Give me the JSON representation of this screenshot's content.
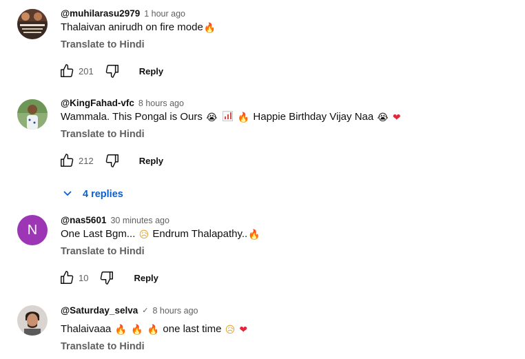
{
  "translate_label": "Translate to Hindi",
  "reply_label": "Reply",
  "colors": {
    "link_blue": "#065fd4",
    "secondary_text": "#606060",
    "avatar_purple": "#9c36b5"
  },
  "comments": [
    {
      "author": "@muhilarasu2979",
      "time": "1 hour ago",
      "text": "Thalaivan anirudh on fire mode",
      "text_emojis": [
        "fire"
      ],
      "likes": "201",
      "avatar": "image"
    },
    {
      "author": "@KingFahad-vfc",
      "time": "8 hours ago",
      "text_parts": [
        "Wammala. This Pongal is Ours",
        "Happie Birthday Vijay Naa"
      ],
      "text_emojis": [
        "loudly-crying-face",
        "chart-increasing",
        "fire",
        "loudly-crying-face",
        "red-heart"
      ],
      "likes": "212",
      "avatar": "image",
      "replies_label": "4 replies"
    },
    {
      "author": "@nas5601",
      "time": "30 minutes ago",
      "text_parts": [
        "One Last Bgm...",
        "Endrum Thalapathy.."
      ],
      "text_emojis": [
        "sad-face",
        "fire"
      ],
      "likes": "10",
      "avatar": "letter",
      "avatar_letter": "N"
    },
    {
      "author": "@Saturday_selva",
      "verified": "✓",
      "time": "8 hours ago",
      "text_parts": [
        "Thalaivaaa",
        "one last time"
      ],
      "text_emojis": [
        "fire",
        "fire",
        "fire",
        "sad-face",
        "red-heart"
      ],
      "avatar": "image"
    }
  ]
}
